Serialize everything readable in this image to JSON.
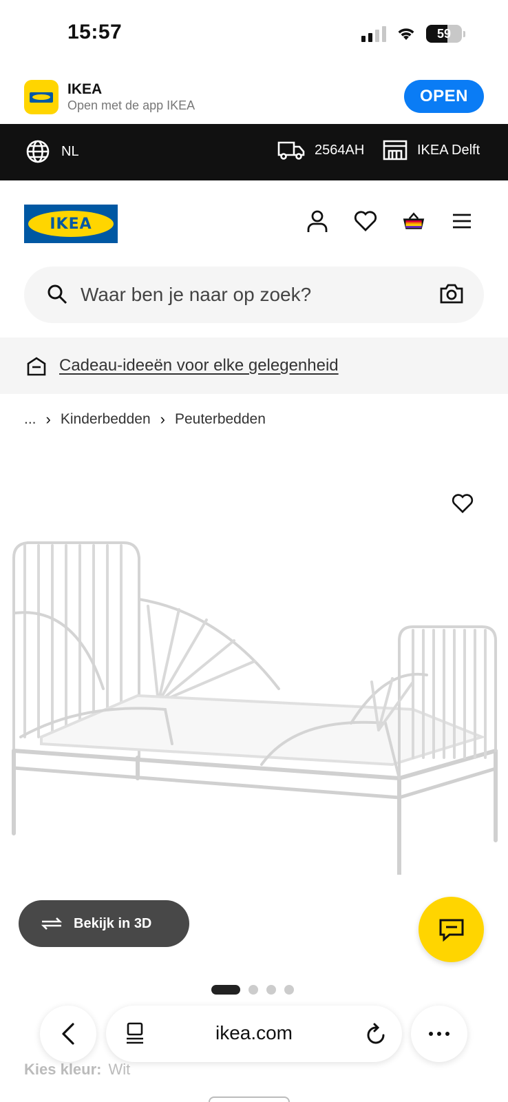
{
  "status": {
    "time": "15:57",
    "battery": "59",
    "battery_level": 0.59
  },
  "app_banner": {
    "name": "IKEA",
    "subtitle": "Open met de app IKEA",
    "open_label": "OPEN"
  },
  "top_bar": {
    "language": "NL",
    "postcode": "2564AH",
    "store": "IKEA Delft"
  },
  "header": {
    "logo_text": "IKEA",
    "icons": [
      "user-icon",
      "heart-icon",
      "basket-icon",
      "menu-icon"
    ]
  },
  "search": {
    "placeholder": "Waar ben je naar op zoek?"
  },
  "promo": {
    "link_text": "Cadeau-ideeën voor elke gelegenheid"
  },
  "breadcrumb": {
    "items": [
      "...",
      "Kinderbedden",
      "Peuterbedden"
    ]
  },
  "product": {
    "view_3d_label": "Bekijk in 3D",
    "gallery_total": 4,
    "gallery_active": 1
  },
  "color": {
    "label": "Kies kleur:",
    "value": "Wit"
  },
  "browser": {
    "url": "ikea.com"
  },
  "colors": {
    "ikea_blue": "#0058a3",
    "ikea_yellow": "#ffd500",
    "open_button": "#0a7cf5"
  }
}
